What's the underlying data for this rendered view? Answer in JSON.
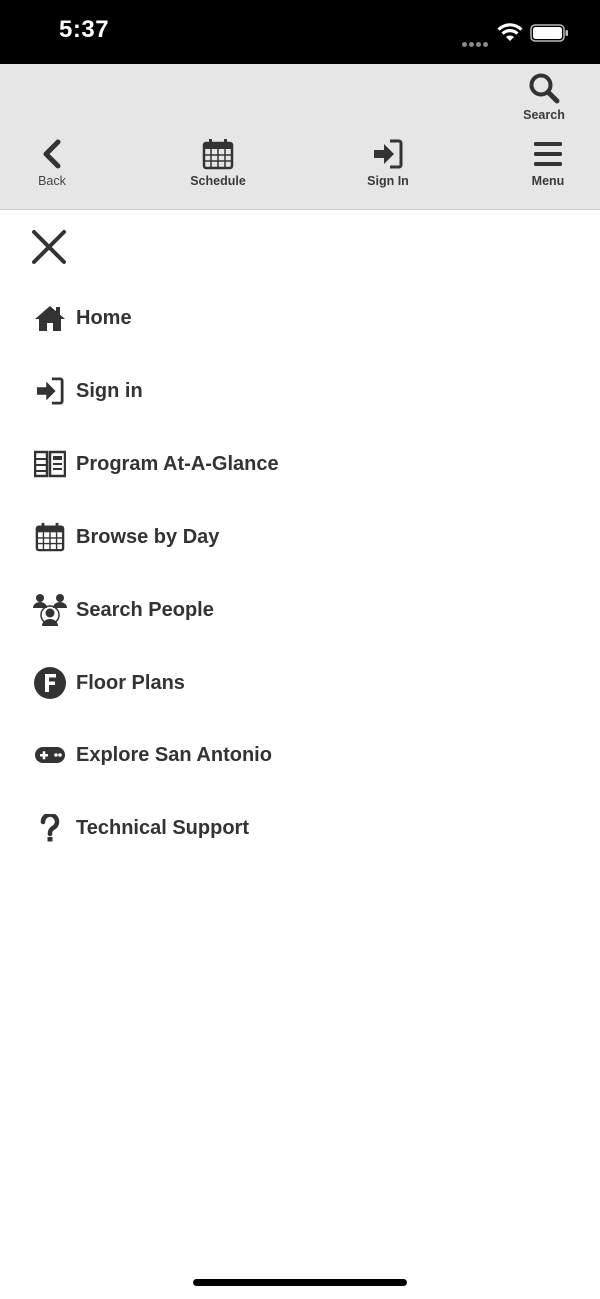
{
  "status_bar": {
    "time": "5:37"
  },
  "toolbar": {
    "search_label": "Search",
    "back_label": "Back",
    "schedule_label": "Schedule",
    "signin_label": "Sign In",
    "menu_label": "Menu"
  },
  "menu": {
    "items": [
      {
        "label": "Home",
        "icon": "home-icon"
      },
      {
        "label": "Sign in",
        "icon": "sign-in-icon"
      },
      {
        "label": "Program At-A-Glance",
        "icon": "program-icon"
      },
      {
        "label": "Browse by Day",
        "icon": "calendar-icon"
      },
      {
        "label": "Search People",
        "icon": "people-icon"
      },
      {
        "label": "Floor Plans",
        "icon": "floor-plans-icon"
      },
      {
        "label": "Explore San Antonio",
        "icon": "gamepad-icon"
      },
      {
        "label": "Technical Support",
        "icon": "question-icon"
      }
    ]
  },
  "colors": {
    "toolbar_bg": "#e6e6e6",
    "text": "#333333",
    "status_bar_bg": "#000000"
  }
}
